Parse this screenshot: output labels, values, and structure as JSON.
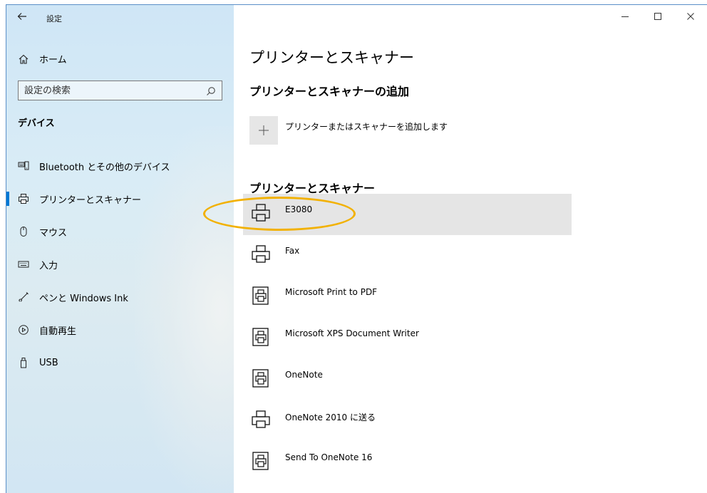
{
  "window": {
    "app_title": "設定",
    "minimize_glyph": "–",
    "maximize_glyph": "□",
    "close_glyph": "✕"
  },
  "sidebar": {
    "home_label": "ホーム",
    "search_placeholder": "設定の検索",
    "section_title": "デバイス",
    "items": [
      {
        "label": "Bluetooth とその他のデバイス",
        "icon": "bluetooth-devices-icon",
        "active": false
      },
      {
        "label": "プリンターとスキャナー",
        "icon": "printer-icon",
        "active": true
      },
      {
        "label": "マウス",
        "icon": "mouse-icon",
        "active": false
      },
      {
        "label": "入力",
        "icon": "keyboard-icon",
        "active": false
      },
      {
        "label": "ペンと Windows Ink",
        "icon": "pen-icon",
        "active": false
      },
      {
        "label": "自動再生",
        "icon": "autoplay-icon",
        "active": false
      },
      {
        "label": "USB",
        "icon": "usb-icon",
        "active": false
      }
    ]
  },
  "main": {
    "page_title": "プリンターとスキャナー",
    "add_section_title": "プリンターとスキャナーの追加",
    "add_button_label": "プリンターまたはスキャナーを追加します",
    "list_title": "プリンターとスキャナー",
    "printers": [
      {
        "name": "E3080",
        "icon": "printer-icon",
        "selected": true
      },
      {
        "name": "Fax",
        "icon": "printer-icon",
        "selected": false
      },
      {
        "name": "Microsoft Print to PDF",
        "icon": "virtual-printer-icon",
        "selected": false
      },
      {
        "name": "Microsoft XPS Document Writer",
        "icon": "virtual-printer-icon",
        "selected": false
      },
      {
        "name": "OneNote",
        "icon": "virtual-printer-icon",
        "selected": false
      },
      {
        "name": "OneNote 2010 に送る",
        "icon": "printer-icon",
        "selected": false
      },
      {
        "name": "Send To OneNote 16",
        "icon": "virtual-printer-icon",
        "selected": false
      }
    ]
  },
  "colors": {
    "accent": "#0078d4",
    "highlight_ring": "#f2b100",
    "selected_row": "#e5e5e5"
  }
}
